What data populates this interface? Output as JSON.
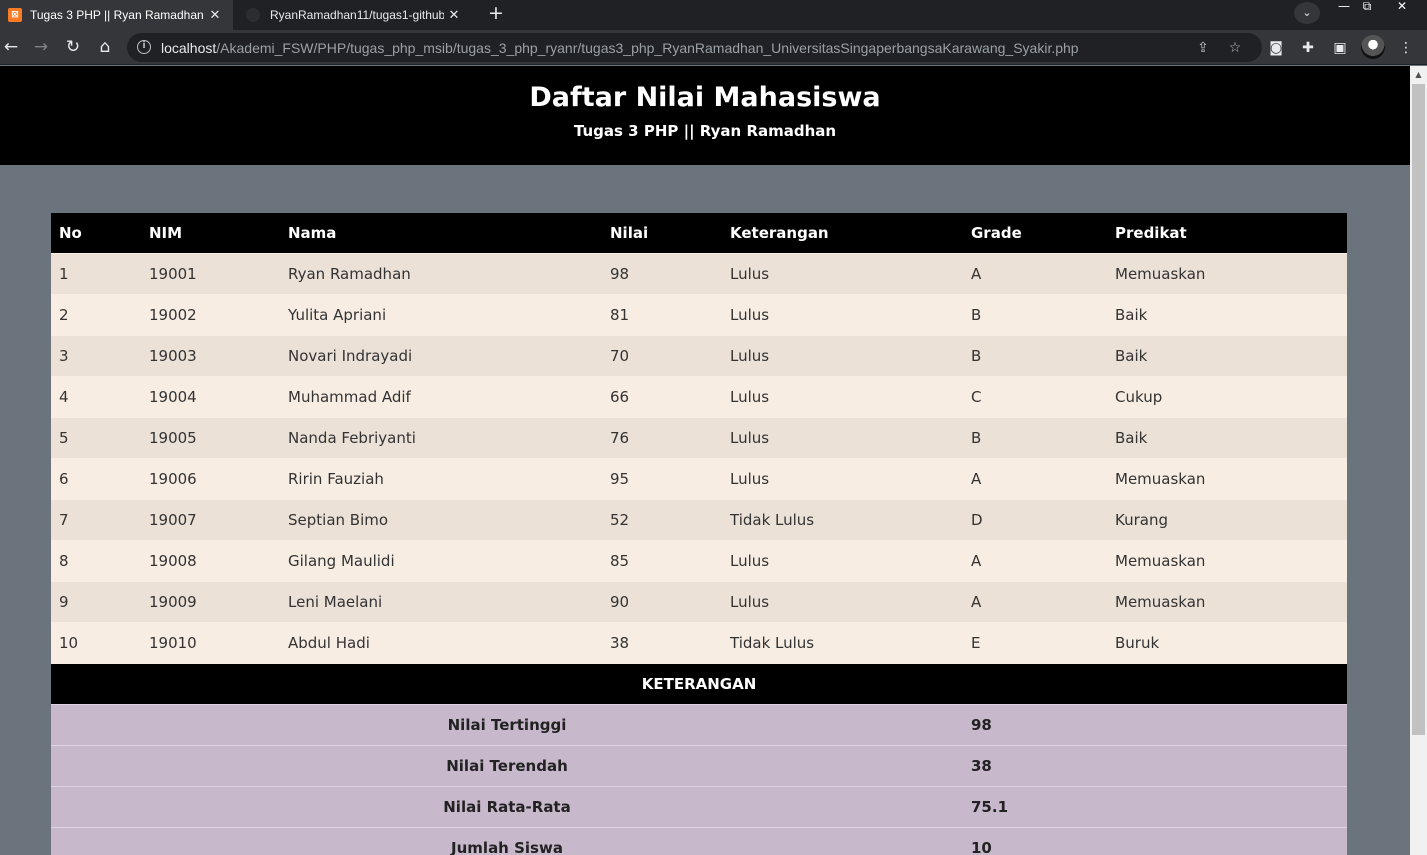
{
  "browser": {
    "tabs": [
      {
        "title": "Tugas 3 PHP || Ryan Ramadhan",
        "active": true
      },
      {
        "title": "RyanRamadhan11/tugas1-github",
        "active": false
      }
    ],
    "url_host": "localhost",
    "url_path": "/Akademi_FSW/PHP/tugas_php_msib/tugas_3_php_ryanr/tugas3_php_RyanRamadhan_UniversitasSingaperbangsaKarawang_Syakir.php"
  },
  "page": {
    "title": "Daftar Nilai Mahasiswa",
    "subtitle": "Tugas 3 PHP || Ryan Ramadhan"
  },
  "table": {
    "headers": [
      "No",
      "NIM",
      "Nama",
      "Nilai",
      "Keterangan",
      "Grade",
      "Predikat"
    ],
    "rows": [
      [
        "1",
        "19001",
        "Ryan Ramadhan",
        "98",
        "Lulus",
        "A",
        "Memuaskan"
      ],
      [
        "2",
        "19002",
        "Yulita Apriani",
        "81",
        "Lulus",
        "B",
        "Baik"
      ],
      [
        "3",
        "19003",
        "Novari Indrayadi",
        "70",
        "Lulus",
        "B",
        "Baik"
      ],
      [
        "4",
        "19004",
        "Muhammad Adif",
        "66",
        "Lulus",
        "C",
        "Cukup"
      ],
      [
        "5",
        "19005",
        "Nanda Febriyanti",
        "76",
        "Lulus",
        "B",
        "Baik"
      ],
      [
        "6",
        "19006",
        "Ririn Fauziah",
        "95",
        "Lulus",
        "A",
        "Memuaskan"
      ],
      [
        "7",
        "19007",
        "Septian Bimo",
        "52",
        "Tidak Lulus",
        "D",
        "Kurang"
      ],
      [
        "8",
        "19008",
        "Gilang Maulidi",
        "85",
        "Lulus",
        "A",
        "Memuaskan"
      ],
      [
        "9",
        "19009",
        "Leni Maelani",
        "90",
        "Lulus",
        "A",
        "Memuaskan"
      ],
      [
        "10",
        "19010",
        "Abdul Hadi",
        "38",
        "Tidak Lulus",
        "E",
        "Buruk"
      ]
    ]
  },
  "keterangan": {
    "title": "KETERANGAN",
    "items": [
      {
        "label": "Nilai Tertinggi",
        "value": "98"
      },
      {
        "label": "Nilai Terendah",
        "value": "38"
      },
      {
        "label": "Nilai Rata-Rata",
        "value": "75.1"
      },
      {
        "label": "Jumlah Siswa",
        "value": "10"
      }
    ]
  },
  "colors": {
    "header_bg": "#000000",
    "page_bg": "#6b737d",
    "row_odd": "#ebe1d7",
    "row_even": "#f8ede3",
    "summary_bg": "#c7b8cc",
    "xampp_favicon": "#fb7a24"
  },
  "icons": [
    "xampp-favicon",
    "github-favicon",
    "close-icon",
    "plus-icon",
    "back-arrow-icon",
    "forward-arrow-icon",
    "reload-icon",
    "home-icon",
    "info-icon",
    "share-icon",
    "star-icon",
    "camera-icon",
    "extensions-icon",
    "side-panel-icon",
    "profile-avatar",
    "menu-kebab-icon"
  ]
}
